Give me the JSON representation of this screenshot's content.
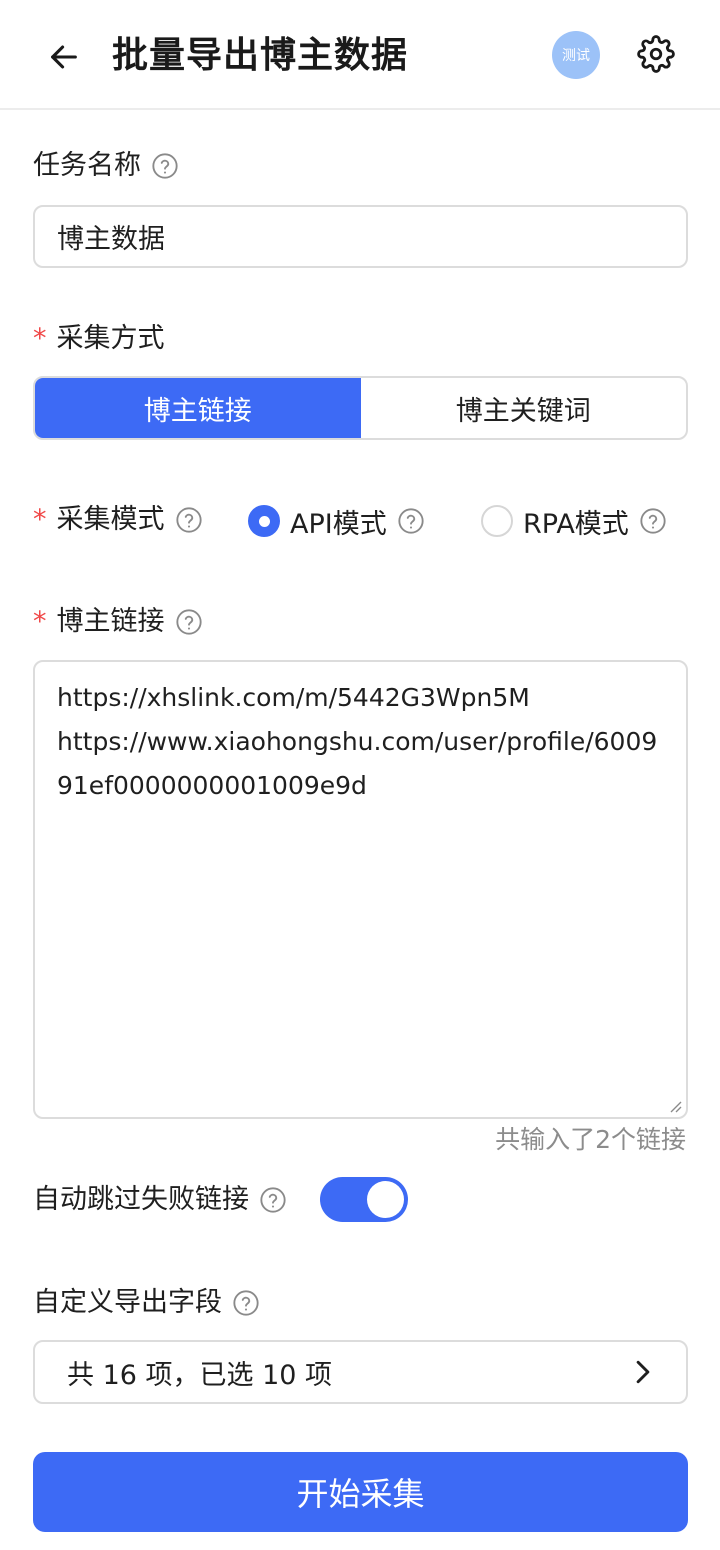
{
  "header": {
    "title": "批量导出博主数据",
    "badge": "测试",
    "back_icon": "arrow-left-icon",
    "settings_icon": "gear-icon"
  },
  "task_name": {
    "label": "任务名称",
    "value": "博主数据"
  },
  "collect_method": {
    "label": "采集方式",
    "options": [
      "博主链接",
      "博主关键词"
    ],
    "selected": "博主链接"
  },
  "collect_mode": {
    "label": "采集模式",
    "options": [
      "API模式",
      "RPA模式"
    ],
    "selected": "API模式"
  },
  "blogger_links": {
    "label": "博主链接",
    "value": "https://xhslink.com/m/5442G3Wpn5M\nhttps://www.xiaohongshu.com/user/profile/600991ef0000000001009e9d",
    "count_note": "共输入了2个链接"
  },
  "auto_skip": {
    "label": "自动跳过失败链接",
    "enabled": true
  },
  "export_fields": {
    "label": "自定义导出字段",
    "summary": "共 16 项，已选 10 项"
  },
  "start_button": {
    "label": "开始采集"
  },
  "colors": {
    "accent": "#3d6af5",
    "required": "#f04848",
    "badge": "#9cc2f8"
  }
}
